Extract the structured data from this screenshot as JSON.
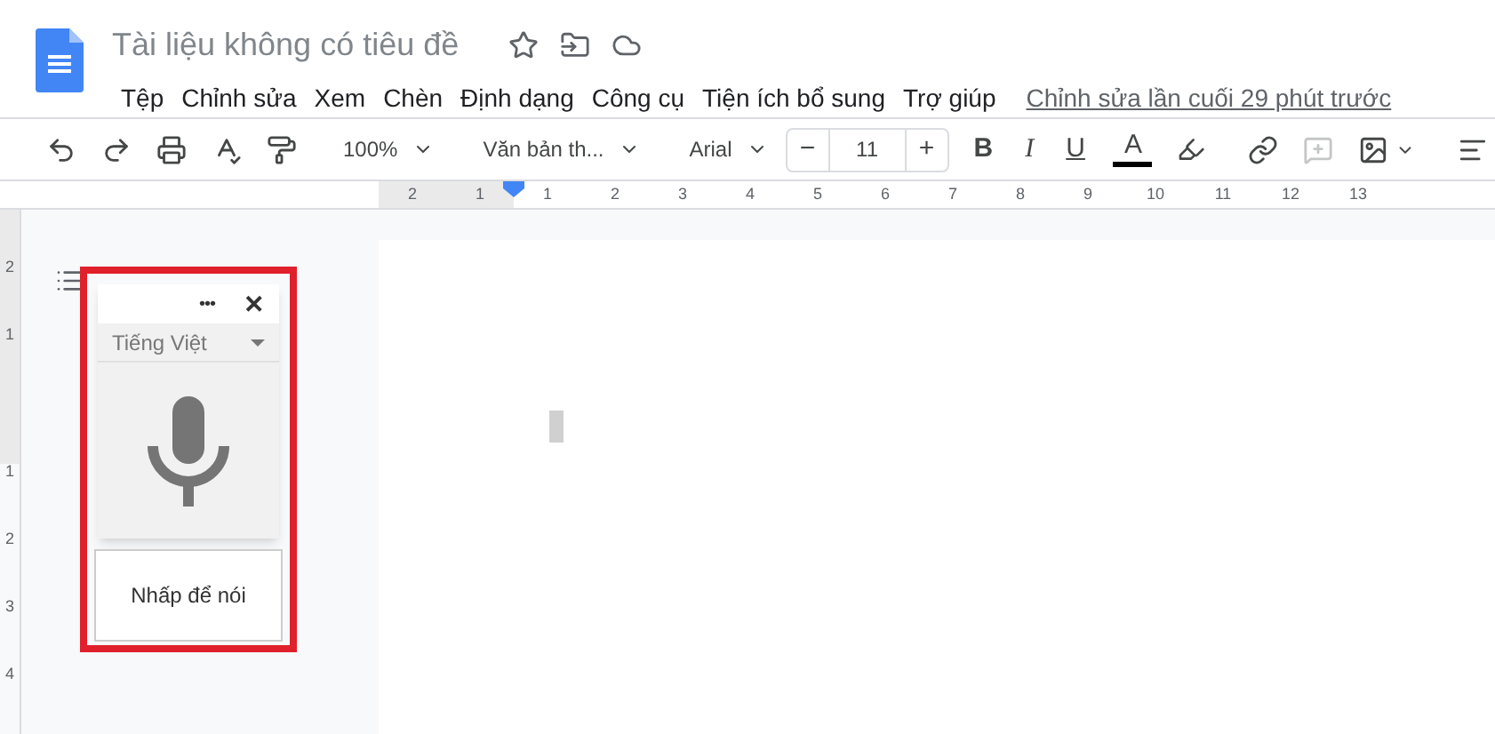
{
  "document": {
    "title": "Tài liệu không có tiêu đề",
    "starred": false
  },
  "menu": [
    "Tệp",
    "Chỉnh sửa",
    "Xem",
    "Chèn",
    "Định dạng",
    "Công cụ",
    "Tiện ích bổ sung",
    "Trợ giúp"
  ],
  "last_edit": "Chỉnh sửa lần cuối 29 phút trước",
  "toolbar": {
    "zoom": "100%",
    "style": "Văn bản th...",
    "font": "Arial",
    "font_size": "11",
    "minus": "−",
    "plus": "+",
    "bold": "B",
    "italic": "I",
    "underline": "U",
    "text_color": "A",
    "comment_disabled": true
  },
  "ruler": {
    "left_labels": [
      "2",
      "1"
    ],
    "right_labels": [
      "1",
      "2",
      "3",
      "4",
      "5",
      "6",
      "7",
      "8",
      "9",
      "10",
      "11",
      "12",
      "13"
    ]
  },
  "vertical_ruler": {
    "top_labels": [
      "2",
      "1"
    ],
    "bottom_labels": [
      "1",
      "2",
      "3",
      "4"
    ]
  },
  "voice_typing": {
    "menu": "•••",
    "close": "✕",
    "language": "Tiếng Việt",
    "hint": "Nhấp để nói",
    "recording": false,
    "highlighted": true
  }
}
